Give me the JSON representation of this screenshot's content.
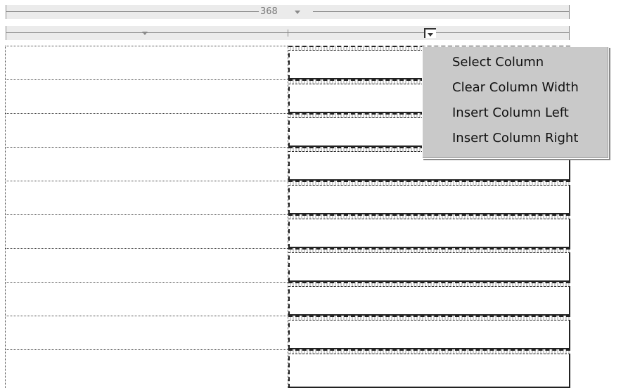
{
  "header": {
    "table_width_label": "368"
  },
  "icons": {
    "width_dropdown": "dropdown-triangle-icon",
    "column_dropdown": "dropdown-triangle-icon",
    "column_menu_button": "chevron-down-icon"
  },
  "context_menu": {
    "items": [
      {
        "label": "Select Column"
      },
      {
        "label": "Clear Column Width"
      },
      {
        "label": "Insert Column Left"
      },
      {
        "label": "Insert Column Right"
      }
    ]
  },
  "table": {
    "columns": 2,
    "rows": 10,
    "selected_column": 2
  },
  "colors": {
    "header_background": "#ebebeb",
    "menu_background": "#c9c9c9",
    "ruler_line": "#8a8a8a"
  }
}
